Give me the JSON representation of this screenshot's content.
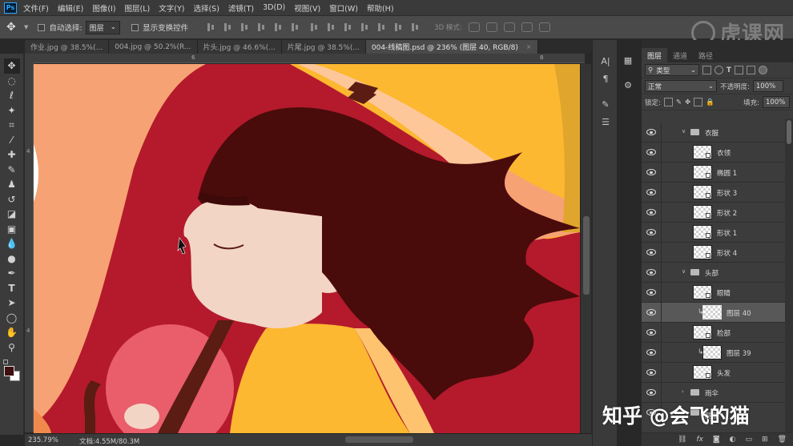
{
  "menu": [
    "文件(F)",
    "编辑(E)",
    "图像(I)",
    "图层(L)",
    "文字(Y)",
    "选择(S)",
    "滤镜(T)",
    "3D(D)",
    "视图(V)",
    "窗口(W)",
    "帮助(H)"
  ],
  "options": {
    "auto_select_label": "自动选择:",
    "auto_select_value": "图层",
    "show_transform_label": "显示变换控件",
    "mode_3d_label": "3D 模式:"
  },
  "watermark_top": "虎课网",
  "tabs": [
    {
      "label": "作业.jpg @ 38.5%(..."
    },
    {
      "label": "004.jpg @ 50.2%(R..."
    },
    {
      "label": "片头.jpg @ 46.6%(..."
    },
    {
      "label": "片尾.jpg @ 38.5%(..."
    },
    {
      "label": "004-线稿图.psd @ 236% (图层 40, RGB/8)"
    }
  ],
  "ruler": {
    "top": [
      "6",
      "8"
    ],
    "left": [
      "4",
      "4"
    ]
  },
  "status": {
    "zoom": "235.79%",
    "doc": "文档:4.55M/80.3M"
  },
  "panel": {
    "tabs": [
      "图层",
      "通道",
      "路径"
    ],
    "filter_label": "类型",
    "blend_mode": "正常",
    "opacity_label": "不透明度:",
    "opacity_value": "100%",
    "lock_label": "锁定:",
    "fill_label": "填充:",
    "fill_value": "100%"
  },
  "layers": [
    {
      "name": "衣服",
      "type": "group"
    },
    {
      "name": "衣领",
      "type": "layer"
    },
    {
      "name": "椭圆 1",
      "type": "layer"
    },
    {
      "name": "形状 3",
      "type": "layer"
    },
    {
      "name": "形状 2",
      "type": "layer"
    },
    {
      "name": "形状 1",
      "type": "layer"
    },
    {
      "name": "形状 4",
      "type": "layer"
    },
    {
      "name": "头部",
      "type": "group"
    },
    {
      "name": "眼睛",
      "type": "layer"
    },
    {
      "name": "图层 40",
      "type": "clip"
    },
    {
      "name": "脸部",
      "type": "layer"
    },
    {
      "name": "图层 39",
      "type": "clip"
    },
    {
      "name": "头发",
      "type": "layer"
    },
    {
      "name": "雨伞",
      "type": "group"
    },
    {
      "name": "腿部",
      "type": "layer"
    }
  ],
  "watermark_bottom": "知乎 @会飞的猫",
  "colors": {
    "foreground": "#400f0f",
    "background": "#ffffff",
    "canvas_red": "#b41a2c",
    "hair": "#4a0b0b",
    "skin": "#f3d5c5",
    "yellow": "#fcb830"
  }
}
